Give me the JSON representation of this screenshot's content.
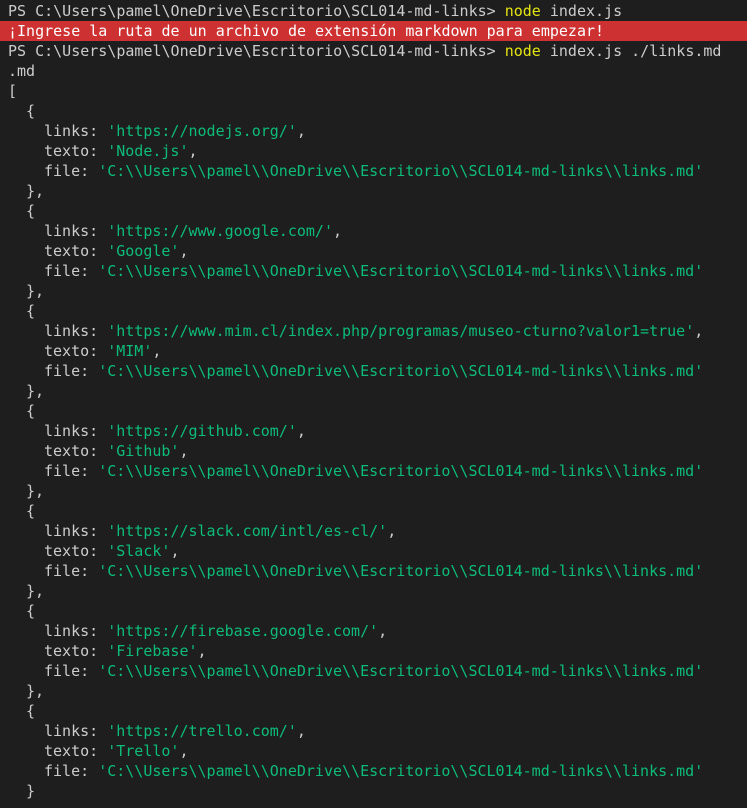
{
  "terminal": {
    "prompt1": {
      "prompt": "PS C:\\Users\\pamel\\OneDrive\\Escritorio\\SCL014-md-links> ",
      "command": "node",
      "args": " index.js"
    },
    "error_line": "¡Ingrese la ruta de un archivo de extensión markdown para empezar!",
    "prompt2": {
      "prompt": "PS C:\\Users\\pamel\\OneDrive\\Escritorio\\SCL014-md-links> ",
      "command": "node",
      "args": " index.js ./links.md"
    },
    "ext_output": ".md",
    "open_bracket": "[",
    "key_links": "links: ",
    "key_texto": "texto: ",
    "key_file": "file: ",
    "links": [
      {
        "url": "'https://nodejs.org/'",
        "text": "'Node.js'",
        "file": "'C:\\\\Users\\\\pamel\\\\OneDrive\\\\Escritorio\\\\SCL014-md-links\\\\links.md'"
      },
      {
        "url": "'https://www.google.com/'",
        "text": "'Google'",
        "file": "'C:\\\\Users\\\\pamel\\\\OneDrive\\\\Escritorio\\\\SCL014-md-links\\\\links.md'"
      },
      {
        "url": "'https://www.mim.cl/index.php/programas/museo-cturno?valor1=true'",
        "text": "'MIM'",
        "file": "'C:\\\\Users\\\\pamel\\\\OneDrive\\\\Escritorio\\\\SCL014-md-links\\\\links.md'"
      },
      {
        "url": "'https://github.com/'",
        "text": "'Github'",
        "file": "'C:\\\\Users\\\\pamel\\\\OneDrive\\\\Escritorio\\\\SCL014-md-links\\\\links.md'"
      },
      {
        "url": "'https://slack.com/intl/es-cl/'",
        "text": "'Slack'",
        "file": "'C:\\\\Users\\\\pamel\\\\OneDrive\\\\Escritorio\\\\SCL014-md-links\\\\links.md'"
      },
      {
        "url": "'https://firebase.google.com/'",
        "text": "'Firebase'",
        "file": "'C:\\\\Users\\\\pamel\\\\OneDrive\\\\Escritorio\\\\SCL014-md-links\\\\links.md'"
      },
      {
        "url": "'https://trello.com/'",
        "text": "'Trello'",
        "file": "'C:\\\\Users\\\\pamel\\\\OneDrive\\\\Escritorio\\\\SCL014-md-links\\\\links.md'"
      }
    ]
  },
  "colors": {
    "background": "#1e1e1e",
    "foreground": "#cccccc",
    "command": "#e5e510",
    "string": "#0dbc79",
    "error_bg": "#cd3131"
  }
}
